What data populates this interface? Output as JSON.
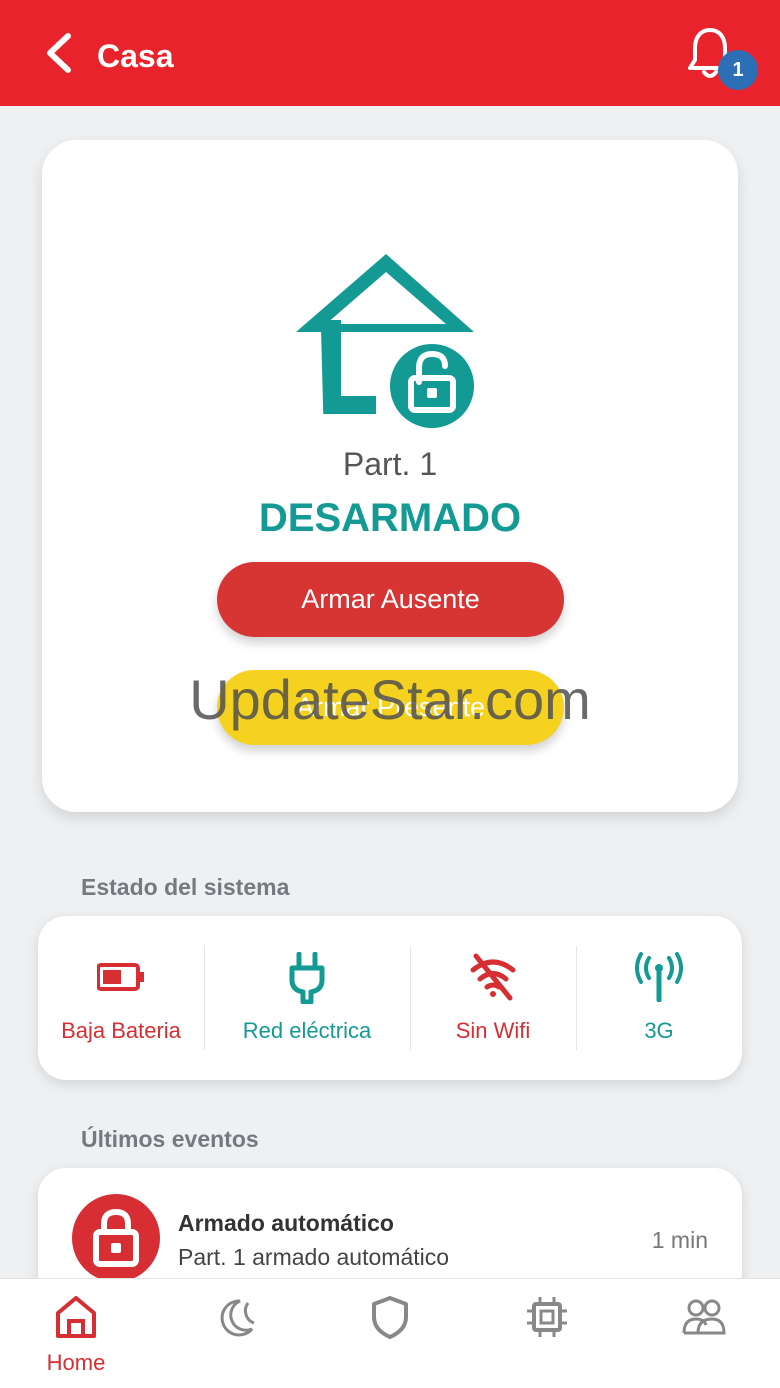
{
  "header": {
    "title": "Casa",
    "notification_count": "1"
  },
  "partition": {
    "label": "Part. 1",
    "state": "DESARMADO",
    "arm_away_label": "Armar Ausente",
    "arm_home_label": "Armar Presente"
  },
  "watermark": "UpdateStar.com",
  "system_status": {
    "title": "Estado del sistema",
    "items": [
      {
        "label": "Baja Bateria",
        "icon": "battery-low-icon",
        "color": "#d72e33"
      },
      {
        "label": "Red eléctrica",
        "icon": "power-plug-icon",
        "color": "#149a94"
      },
      {
        "label": "Sin Wifi",
        "icon": "wifi-off-icon",
        "color": "#d72e33"
      },
      {
        "label": "3G",
        "icon": "antenna-signal-icon",
        "color": "#149a94"
      }
    ]
  },
  "events": {
    "title": "Últimos eventos",
    "items": [
      {
        "title": "Armado automático",
        "subtitle": "Part. 1 armado automático",
        "time": "1 min",
        "icon": "lock-icon"
      }
    ]
  },
  "bottom_nav": {
    "items": [
      {
        "label": "Home",
        "icon": "home-icon",
        "active": true
      },
      {
        "label": "",
        "icon": "moon-icon"
      },
      {
        "label": "",
        "icon": "shield-icon"
      },
      {
        "label": "",
        "icon": "chip-icon"
      },
      {
        "label": "",
        "icon": "users-icon"
      }
    ]
  },
  "colors": {
    "brand_red": "#e8232b",
    "teal": "#149a94",
    "yellow": "#f5d21f",
    "badge_blue": "#2c6fb6"
  }
}
